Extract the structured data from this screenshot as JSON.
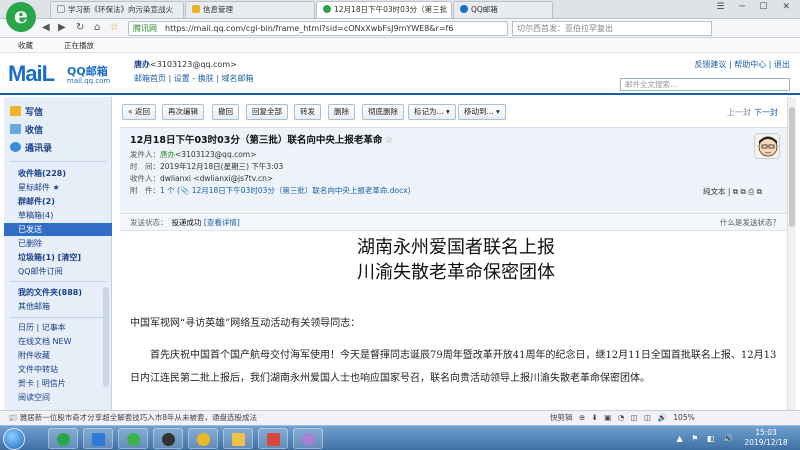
{
  "browser": {
    "tabs": [
      {
        "label": "学习新《环保法》向污染宣战火"
      },
      {
        "label": "信息管理"
      },
      {
        "label": "12月18日下午03时03分（第三批"
      },
      {
        "label": "QQ邮箱"
      }
    ],
    "site_label": "腾讯网",
    "url": "https://mail.qq.com/cgi-bin/frame_html?sid=cONxXwbFsJ9mYWE8&r=f6",
    "search_text": "切尔西首发：亚伯拉罕复出",
    "bookmarks": {
      "favorites": "收藏",
      "watching": "正在播放"
    },
    "window_controls": "☰ ─ ☐ ✕"
  },
  "mail_header": {
    "logo_text": "MaiL",
    "logo_cn": "QQ邮箱",
    "logo_sub": "mail.qq.com",
    "user_name": "唐办",
    "user_email": "<3103123@qq.com>",
    "user_links": "邮箱首页 | 设置 - 换肤 | 域名邮箱",
    "top_links": "反馈建议 | 帮助中心 | 退出",
    "search_placeholder": "邮件全文搜索..."
  },
  "sidebar": {
    "write": "写信",
    "receive": "收信",
    "contacts": "通讯录",
    "items": [
      {
        "label": "收件箱(228)"
      },
      {
        "label": "星标邮件 ★"
      },
      {
        "label": "群邮件(2)"
      },
      {
        "label": "草稿箱(4)"
      },
      {
        "label": "已发送"
      },
      {
        "label": "已删除"
      },
      {
        "label": "垃圾箱(1)    [清空]"
      },
      {
        "label": "QQ邮件订阅"
      },
      {
        "label": "我的文件夹(888)"
      },
      {
        "label": "其他邮箱"
      },
      {
        "label": "日历 | 记事本"
      },
      {
        "label": "在线文档 NEW"
      },
      {
        "label": "附件收藏"
      },
      {
        "label": "文件中转站"
      },
      {
        "label": "贺卡 | 明信片"
      },
      {
        "label": "阅读空间"
      }
    ]
  },
  "toolbar": {
    "back": "« 返回",
    "buttons": [
      "再次编辑",
      "撤回",
      "回复全部",
      "转发",
      "删除",
      "彻底删除",
      "标记为... ▾",
      "移动到... ▾"
    ],
    "prev": "上一封",
    "next": "下一封"
  },
  "mail": {
    "subject": "12月18日下午03时03分（第三批）联名向中央上报老革命",
    "star": "☆",
    "sender_label": "发件人：",
    "sender_name": "唐办",
    "sender_email": "<3103123@qq.com>",
    "time_label": "时　间：",
    "time_value": "2019年12月18日(星期三) 下午3:03",
    "recipient_label": "收件人：",
    "recipient_value": "dwlianxi <dwlianxi@js7tv.cn>",
    "attachment_label": "附　件：",
    "attachment_value": "1 个 (📎 12月18日下午03时03分（第三批）联名向中央上报老革命.docx)",
    "plain_text": "纯文本 | ⧉ ⧉ ⎙ ⧉",
    "send_status_label": "发送状态：",
    "send_status_value": "投递成功",
    "send_status_link": "[查看详情]",
    "send_status_help": "什么是发送状态？",
    "letter_title_1": "湖南永州爱国者联名上报",
    "letter_title_2": "川渝失散老革命保密团体",
    "greeting": "中国军视网“寻访英雄”网络互动活动有关领导同志：",
    "paragraph": "首先庆祝中国首个国产航母交付海军使用！今天是督揮同志诞辰79周年暨改革开放41周年的纪念日，继12月11日全国首批联名上报、12月13日内江连民第二批上报后，我们湖南永州爱国人士也响应国家号召，联名向贵活动领导上报川渝失散老革命保密团体。"
  },
  "status_bar": {
    "news": "📰 雅居新一位股市奇才分享超全解套技巧入市8年从未被套，通盘选股成法",
    "right": "快剪辑 ⊕ ⬇ ▣ ◔ ◫ ◫ 🔊 105%"
  },
  "taskbar": {
    "time": "15:03",
    "date": "2019/12/18",
    "tray": "▲ ⚑ ◧ 🔊"
  },
  "colors": {
    "brand": "#1a6ec9",
    "selected": "#2f6dc6",
    "link": "#1a5fa8"
  }
}
